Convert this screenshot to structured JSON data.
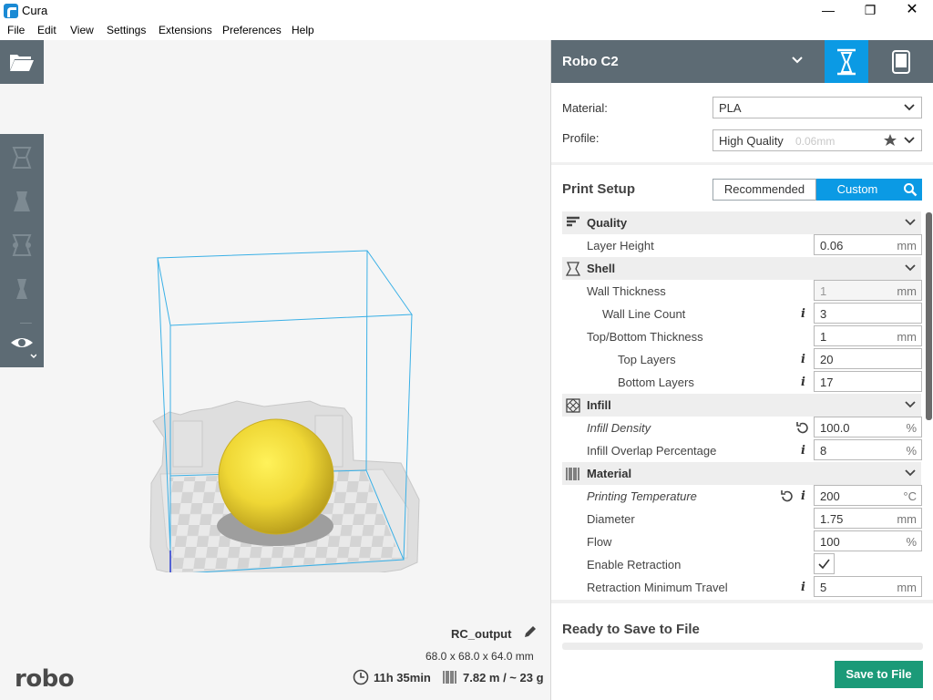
{
  "window": {
    "title": "Cura",
    "minimize": "—",
    "maximize": "❐",
    "close": "✕"
  },
  "menu": [
    "File",
    "Edit",
    "View",
    "Settings",
    "Extensions",
    "Preferences",
    "Help"
  ],
  "viewport": {
    "logo": "robo",
    "job_name": "RC_output",
    "dimensions": "68.0 x 68.0 x 64.0 mm",
    "print_time": "11h 35min",
    "material_estimate": "7.82 m / ~ 23 g",
    "icons": [
      "open-folder-icon",
      "move-tool-icon",
      "scale-tool-icon",
      "rotate-tool-icon",
      "mirror-tool-icon",
      "per-model-settings-icon",
      "view-mode-eye-icon"
    ]
  },
  "sidebar": {
    "printer_name": "Robo C2",
    "material_label": "Material:",
    "material_value": "PLA",
    "profile_label": "Profile:",
    "profile_value": "High Quality",
    "profile_detail": "0.06mm",
    "print_setup_title": "Print Setup",
    "mode_recommended": "Recommended",
    "mode_custom": "Custom",
    "categories": {
      "quality": "Quality",
      "shell": "Shell",
      "infill": "Infill",
      "material": "Material"
    },
    "settings": {
      "layer_height": {
        "label": "Layer Height",
        "value": "0.06",
        "unit": "mm"
      },
      "wall_thickness": {
        "label": "Wall Thickness",
        "value": "1",
        "unit": "mm"
      },
      "wall_line_count": {
        "label": "Wall Line Count",
        "value": "3"
      },
      "top_bottom_thickness": {
        "label": "Top/Bottom Thickness",
        "value": "1",
        "unit": "mm"
      },
      "top_layers": {
        "label": "Top Layers",
        "value": "20"
      },
      "bottom_layers": {
        "label": "Bottom Layers",
        "value": "17"
      },
      "infill_density": {
        "label": "Infill Density",
        "value": "100.0",
        "unit": "%"
      },
      "infill_overlap": {
        "label": "Infill Overlap Percentage",
        "value": "8",
        "unit": "%"
      },
      "printing_temperature": {
        "label": "Printing Temperature",
        "value": "200",
        "unit": "°C"
      },
      "diameter": {
        "label": "Diameter",
        "value": "1.75",
        "unit": "mm"
      },
      "flow": {
        "label": "Flow",
        "value": "100",
        "unit": "%"
      },
      "enable_retraction": {
        "label": "Enable Retraction",
        "checked": true
      },
      "retraction_min_travel": {
        "label": "Retraction Minimum Travel",
        "value": "5",
        "unit": "mm"
      }
    },
    "info_glyph": "i",
    "save_status": "Ready to Save to File",
    "save_progress": 0,
    "save_button": "Save to File"
  },
  "colors": {
    "accent": "#0b9ae4",
    "header": "#5d6b74",
    "save": "#1b9a78",
    "model": "#f2d93a"
  }
}
